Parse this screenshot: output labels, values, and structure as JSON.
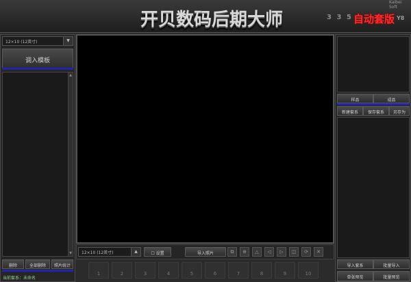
{
  "header": {
    "title": "开贝数码后期大师",
    "nums": "3 3 5",
    "brand": "自动套版",
    "brand_sub": "Y8",
    "top_mini": "Kaibei Soft"
  },
  "left": {
    "size_select": "12×10 (12英寸)",
    "size_arrow": "▼",
    "load_template": "调入模板",
    "delete": "删除",
    "delete_all": "全部删除",
    "stats": "照片统计",
    "status": "当前套系：未命名"
  },
  "bottom": {
    "size_select": "12×10 (12英寸)",
    "settings": "设置",
    "import_photo": "导入照片",
    "thumbs": [
      "1",
      "2",
      "3",
      "4",
      "5",
      "6",
      "7",
      "8",
      "9",
      "10"
    ]
  },
  "right": {
    "sample": "样品",
    "finished": "成品",
    "new_set": "新建套系",
    "save_set": "保存套系",
    "save_as": "另存为",
    "import_set": "导入套系",
    "batch_import": "批量导入",
    "single_preview": "单张预览",
    "batch_preview": "批量预览"
  }
}
